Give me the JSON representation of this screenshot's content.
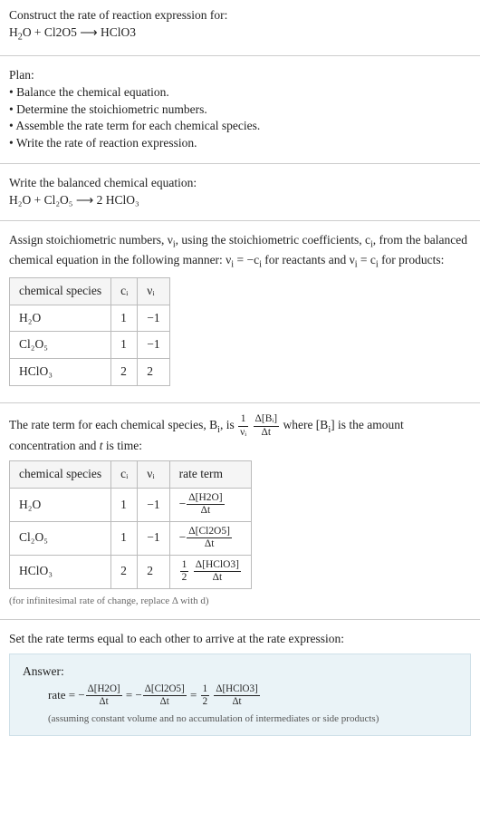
{
  "header": {
    "prompt": "Construct the rate of reaction expression for:",
    "equation_lhs1": "H",
    "equation_lhs1_sub": "2",
    "equation_lhs1b": "O + Cl2O5 ⟶ HClO3"
  },
  "plan": {
    "title": "Plan:",
    "items": [
      "Balance the chemical equation.",
      "Determine the stoichiometric numbers.",
      "Assemble the rate term for each chemical species.",
      "Write the rate of reaction expression."
    ]
  },
  "balanced": {
    "title": "Write the balanced chemical equation:",
    "eq": "H₂O + Cl₂O₅ ⟶ 2 HClO₃"
  },
  "stoich": {
    "intro1": "Assign stoichiometric numbers, ν",
    "intro1_sub": "i",
    "intro2": ", using the stoichiometric coefficients, c",
    "intro2_sub": "i",
    "intro3": ", from the balanced chemical equation in the following manner: ν",
    "intro3_sub": "i",
    "intro4": " = −c",
    "intro4_sub": "i",
    "intro5": " for reactants and ν",
    "intro5_sub": "i",
    "intro6": " = c",
    "intro6_sub": "i",
    "intro7": " for products:",
    "table": {
      "headers": [
        "chemical species",
        "cᵢ",
        "νᵢ"
      ],
      "rows": [
        {
          "species": "H₂O",
          "c": "1",
          "v": "−1"
        },
        {
          "species": "Cl₂O₅",
          "c": "1",
          "v": "−1"
        },
        {
          "species": "HClO₃",
          "c": "2",
          "v": "2"
        }
      ]
    }
  },
  "rateterm": {
    "intro_a": "The rate term for each chemical species, B",
    "intro_a_sub": "i",
    "intro_b": ", is ",
    "frac1_n": "1",
    "frac1_d": "νᵢ",
    "frac2_n": "Δ[Bᵢ]",
    "frac2_d": "Δt",
    "intro_c": " where [B",
    "intro_c_sub": "i",
    "intro_d": "] is the amount concentration and ",
    "intro_e": "t",
    "intro_f": " is time:",
    "table": {
      "headers": [
        "chemical species",
        "cᵢ",
        "νᵢ",
        "rate term"
      ],
      "rows": [
        {
          "species": "H₂O",
          "c": "1",
          "v": "−1",
          "rate_neg": "−",
          "rate_n": "Δ[H2O]",
          "rate_d": "Δt"
        },
        {
          "species": "Cl₂O₅",
          "c": "1",
          "v": "−1",
          "rate_neg": "−",
          "rate_n": "Δ[Cl2O5]",
          "rate_d": "Δt"
        },
        {
          "species": "HClO₃",
          "c": "2",
          "v": "2",
          "rate_pre_n": "1",
          "rate_pre_d": "2",
          "rate_n": "Δ[HClO3]",
          "rate_d": "Δt"
        }
      ]
    },
    "footnote": "(for infinitesimal rate of change, replace Δ with d)"
  },
  "final": {
    "intro": "Set the rate terms equal to each other to arrive at the rate expression:",
    "answer_label": "Answer:",
    "rate_word": "rate = −",
    "t1_n": "Δ[H2O]",
    "t1_d": "Δt",
    "eq1": " = −",
    "t2_n": "Δ[Cl2O5]",
    "t2_d": "Δt",
    "eq2": " = ",
    "t3a_n": "1",
    "t3a_d": "2",
    "t3_n": "Δ[HClO3]",
    "t3_d": "Δt",
    "note": "(assuming constant volume and no accumulation of intermediates or side products)"
  }
}
